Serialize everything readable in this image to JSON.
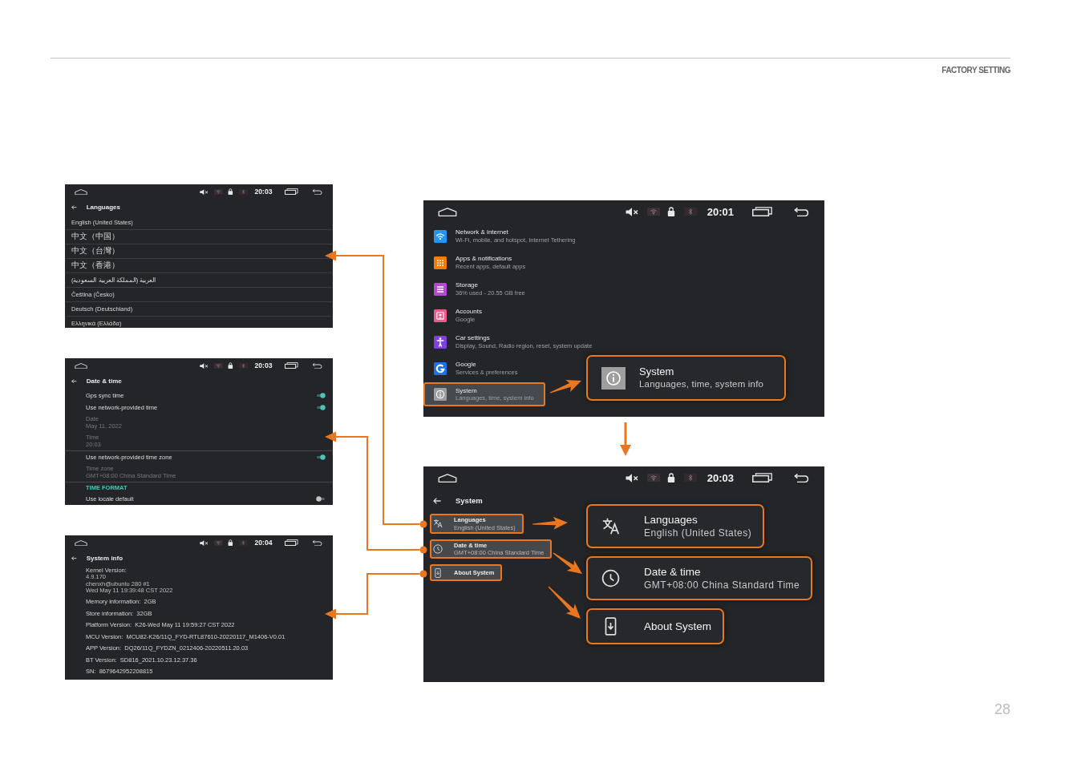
{
  "header": {
    "section_title": "FACTORY SETTING"
  },
  "detail_screens": [
    {
      "kind": "languages",
      "time": "20:03",
      "title": "Languages",
      "options": [
        "English (United States)",
        "中文（中国）",
        "中文（台灣）",
        "中文（香港）",
        "العربية (المملكة العربية السعودية)",
        "Čeština (Česko)",
        "Deutsch (Deutschland)",
        "Ελληνικά (Ελλάδα)"
      ]
    },
    {
      "kind": "date_time",
      "time": "20:03",
      "title": "Date & time",
      "sections": [
        {
          "items": [
            {
              "kind": "switch",
              "label": "Gps sync time",
              "on": true,
              "disabled": false
            },
            {
              "kind": "switch",
              "label": "Use network-provided time",
              "on": true,
              "disabled": false
            },
            {
              "kind": "value",
              "label": "Date",
              "value": "May 11, 2022",
              "disabled": true
            },
            {
              "kind": "value",
              "label": "Time",
              "value": "20:03",
              "disabled": true
            }
          ]
        },
        {
          "items": [
            {
              "kind": "switch",
              "label": "Use network-provided time zone",
              "on": true,
              "disabled": false
            },
            {
              "kind": "value",
              "label": "Time zone",
              "value": "GMT+08:00 China Standard Time",
              "disabled": true
            }
          ]
        },
        {
          "header": "TIME FORMAT",
          "items": [
            {
              "kind": "switch",
              "label": "Use locale default",
              "on": false,
              "disabled": false
            }
          ]
        }
      ]
    },
    {
      "kind": "system_info",
      "time": "20:04",
      "title": "System info",
      "entries": [
        {
          "kind": "block",
          "label": "Kernel Version:",
          "lines": [
            "4.9.170",
            "chenxh@ubuntu 280 #1",
            "Wed May 11 19:39:48 CST 2022"
          ]
        },
        {
          "kind": "line",
          "text": "Memory information:  2GB"
        },
        {
          "kind": "line",
          "text": "Store information:  32GB"
        },
        {
          "kind": "line",
          "text": "Platform Version:  K26-Wed May 11 19:59:27 CST 2022"
        },
        {
          "kind": "line",
          "text": "MCU Version:  MCU82-K26/11Q_FYD-RTL87610-20220117_M1406-V0.01"
        },
        {
          "kind": "line",
          "text": "APP Version:  DQ26/11Q_FYDZN_0212406-20220511.20.03"
        },
        {
          "kind": "line",
          "text": "BT Version:  SD816_2021.10.23.12.37.36"
        },
        {
          "kind": "line",
          "text": "SN:  8679642952208815"
        }
      ]
    }
  ],
  "main_screens": [
    {
      "kind": "settings",
      "time": "20:01",
      "items": [
        {
          "title": "Network & internet",
          "subtitle": "Wi-Fi, mobile, and hotspot, Internet Tethering",
          "color": "#2196f3",
          "selected": false
        },
        {
          "title": "Apps & notifications",
          "subtitle": "Recent apps, default apps",
          "color": "#f57c00",
          "selected": false
        },
        {
          "title": "Storage",
          "subtitle": "36% used - 20.55 GB free",
          "color": "#b54bd3",
          "selected": false
        },
        {
          "title": "Accounts",
          "subtitle": "Google",
          "color": "#ec5b8c",
          "selected": false
        },
        {
          "title": "Car settings",
          "subtitle": "Display, Sound, Radio region, reset, system update",
          "color": "#7c43e0",
          "selected": false
        },
        {
          "title": "Google",
          "subtitle": "Services & preferences",
          "color": "#1a73e8",
          "selected": false
        },
        {
          "title": "System",
          "subtitle": "Languages, time, system info",
          "color": "#9e9e9e",
          "selected": true
        }
      ],
      "callouts": [
        {
          "title": "System",
          "subtitle": "Languages, time, system info"
        }
      ]
    },
    {
      "kind": "system",
      "time": "20:03",
      "title": "System",
      "items": [
        {
          "title": "Languages",
          "subtitle": "English (United States)",
          "highlighted": true
        },
        {
          "title": "Date & time",
          "subtitle": "GMT+08:00 China Standard Time",
          "highlighted": true
        },
        {
          "title": "About System",
          "highlighted": true
        }
      ],
      "callouts": [
        {
          "title": "Languages",
          "subtitle": "English (United States)"
        },
        {
          "title": "Date & time",
          "subtitle": "GMT+08:00 China Standard Time"
        },
        {
          "title": "About System"
        }
      ]
    }
  ],
  "page_number": "28"
}
